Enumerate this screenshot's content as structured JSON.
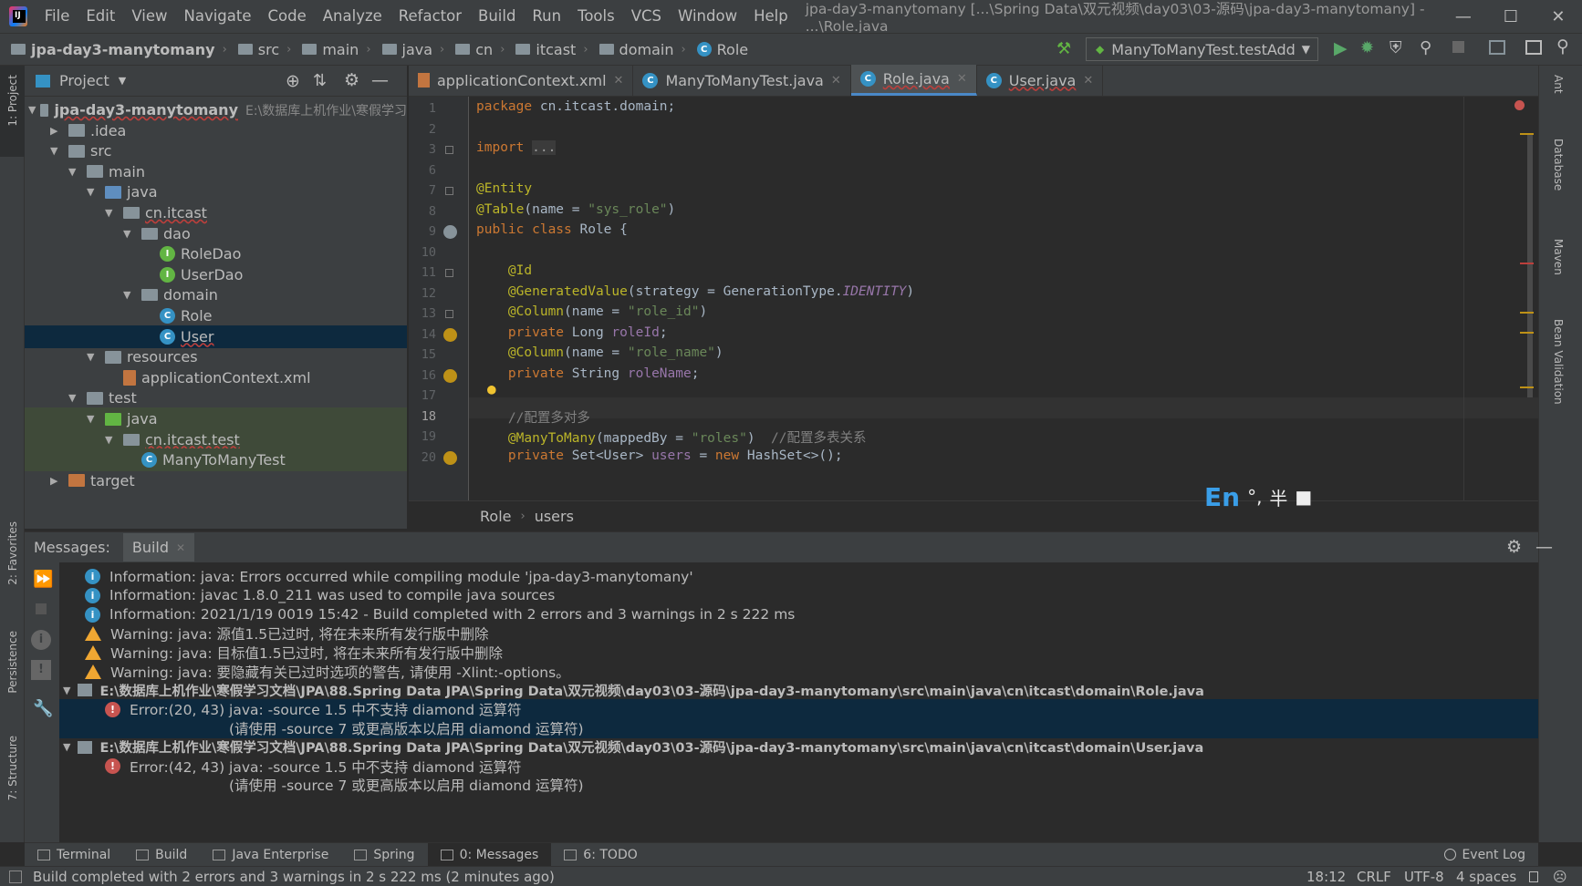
{
  "titlebar": {
    "menu": [
      "File",
      "Edit",
      "View",
      "Navigate",
      "Code",
      "Analyze",
      "Refactor",
      "Build",
      "Run",
      "Tools",
      "VCS",
      "Window",
      "Help"
    ],
    "title": "jpa-day3-manytomany [...\\Spring Data\\双元视频\\day03\\03-源码\\jpa-day3-manytomany] - ...\\Role.java"
  },
  "navbar": {
    "crumbs": [
      "jpa-day3-manytomany",
      "src",
      "main",
      "java",
      "cn",
      "itcast",
      "domain",
      "Role"
    ],
    "run_config": "ManyToManyTest.testAdd"
  },
  "leftstrip": {
    "project": "1: Project",
    "favorites": "2: Favorites",
    "persistence": "Persistence",
    "structure": "7: Structure"
  },
  "rightstrip": {
    "ant": "Ant",
    "database": "Database",
    "maven": "Maven",
    "bean": "Bean Validation"
  },
  "project": {
    "header": "Project",
    "tree": [
      {
        "label": "jpa-day3-manytomany",
        "extra": "E:\\数据库上机作业\\寒假学习",
        "depth": 0,
        "type": "module",
        "open": true
      },
      {
        "label": ".idea",
        "depth": 1,
        "type": "folder",
        "open": false
      },
      {
        "label": "src",
        "depth": 1,
        "type": "folder",
        "open": true
      },
      {
        "label": "main",
        "depth": 2,
        "type": "folder",
        "open": true
      },
      {
        "label": "java",
        "depth": 3,
        "type": "src",
        "open": true
      },
      {
        "label": "cn.itcast",
        "depth": 4,
        "type": "pkg",
        "open": true
      },
      {
        "label": "dao",
        "depth": 5,
        "type": "pkg",
        "open": true
      },
      {
        "label": "RoleDao",
        "depth": 6,
        "type": "iface"
      },
      {
        "label": "UserDao",
        "depth": 6,
        "type": "iface"
      },
      {
        "label": "domain",
        "depth": 5,
        "type": "pkg",
        "open": true
      },
      {
        "label": "Role",
        "depth": 6,
        "type": "class"
      },
      {
        "label": "User",
        "depth": 6,
        "type": "class",
        "selected": true
      },
      {
        "label": "resources",
        "depth": 3,
        "type": "res",
        "open": true
      },
      {
        "label": "applicationContext.xml",
        "depth": 4,
        "type": "xml"
      },
      {
        "label": "test",
        "depth": 2,
        "type": "folder",
        "open": true
      },
      {
        "label": "java",
        "depth": 3,
        "type": "tst",
        "open": true
      },
      {
        "label": "cn.itcast.test",
        "depth": 4,
        "type": "pkg",
        "open": true
      },
      {
        "label": "ManyToManyTest",
        "depth": 5,
        "type": "class"
      },
      {
        "label": "target",
        "depth": 1,
        "type": "tgt",
        "open": false
      }
    ]
  },
  "editor": {
    "tabs": [
      {
        "label": "applicationContext.xml",
        "active": false
      },
      {
        "label": "ManyToManyTest.java",
        "active": false
      },
      {
        "label": "Role.java",
        "active": true
      },
      {
        "label": "User.java",
        "active": false
      }
    ],
    "line_numbers": [
      "1",
      "2",
      "3",
      "6",
      "7",
      "8",
      "9",
      "10",
      "11",
      "12",
      "13",
      "14",
      "15",
      "16",
      "17",
      "18",
      "19",
      "20"
    ],
    "breadcrumb": [
      "Role",
      "users"
    ]
  },
  "messages": {
    "tab_title": "Messages:",
    "tab_build": "Build",
    "rows": [
      {
        "kind": "info",
        "text": "Information: java: Errors occurred while compiling module 'jpa-day3-manytomany'"
      },
      {
        "kind": "info",
        "text": "Information: javac 1.8.0_211 was used to compile java sources"
      },
      {
        "kind": "info",
        "text": "Information: 2021/1/19 0019 15:42 - Build completed with 2 errors and 3 warnings in 2 s 222 ms"
      },
      {
        "kind": "warn",
        "text": "Warning: java: 源值1.5已过时, 将在未来所有发行版中删除"
      },
      {
        "kind": "warn",
        "text": "Warning: java: 目标值1.5已过时, 将在未来所有发行版中删除"
      },
      {
        "kind": "warn",
        "text": "Warning: java: 要隐藏有关已过时选项的警告, 请使用 -Xlint:-options。"
      },
      {
        "kind": "file",
        "text": "E:\\数据库上机作业\\寒假学习文档\\JPA\\88.Spring Data JPA\\Spring Data\\双元视频\\day03\\03-源码\\jpa-day3-manytomany\\src\\main\\java\\cn\\itcast\\domain\\Role.java"
      },
      {
        "kind": "err",
        "text": "Error:(20, 43)  java: -source 1.5 中不支持 diamond 运算符",
        "selected": true
      },
      {
        "kind": "cont",
        "text": "(请使用 -source 7 或更高版本以启用 diamond 运算符)",
        "selected": true
      },
      {
        "kind": "file",
        "text": "E:\\数据库上机作业\\寒假学习文档\\JPA\\88.Spring Data JPA\\Spring Data\\双元视频\\day03\\03-源码\\jpa-day3-manytomany\\src\\main\\java\\cn\\itcast\\domain\\User.java"
      },
      {
        "kind": "err",
        "text": "Error:(42, 43)  java: -source 1.5 中不支持 diamond 运算符"
      },
      {
        "kind": "cont",
        "text": "(请使用 -source 7 或更高版本以启用 diamond 运算符)"
      }
    ]
  },
  "bottomtabs": [
    "Terminal",
    "Build",
    "Java Enterprise",
    "Spring",
    "0: Messages",
    "6: TODO"
  ],
  "event_log": "Event Log",
  "status": {
    "text": "Build completed with 2 errors and 3 warnings in 2 s 222 ms (2 minutes ago)",
    "position": "18:12",
    "line_sep": "CRLF",
    "encoding": "UTF-8",
    "indent": "4 spaces"
  },
  "ime": {
    "lang": "En",
    "mode": "半"
  }
}
